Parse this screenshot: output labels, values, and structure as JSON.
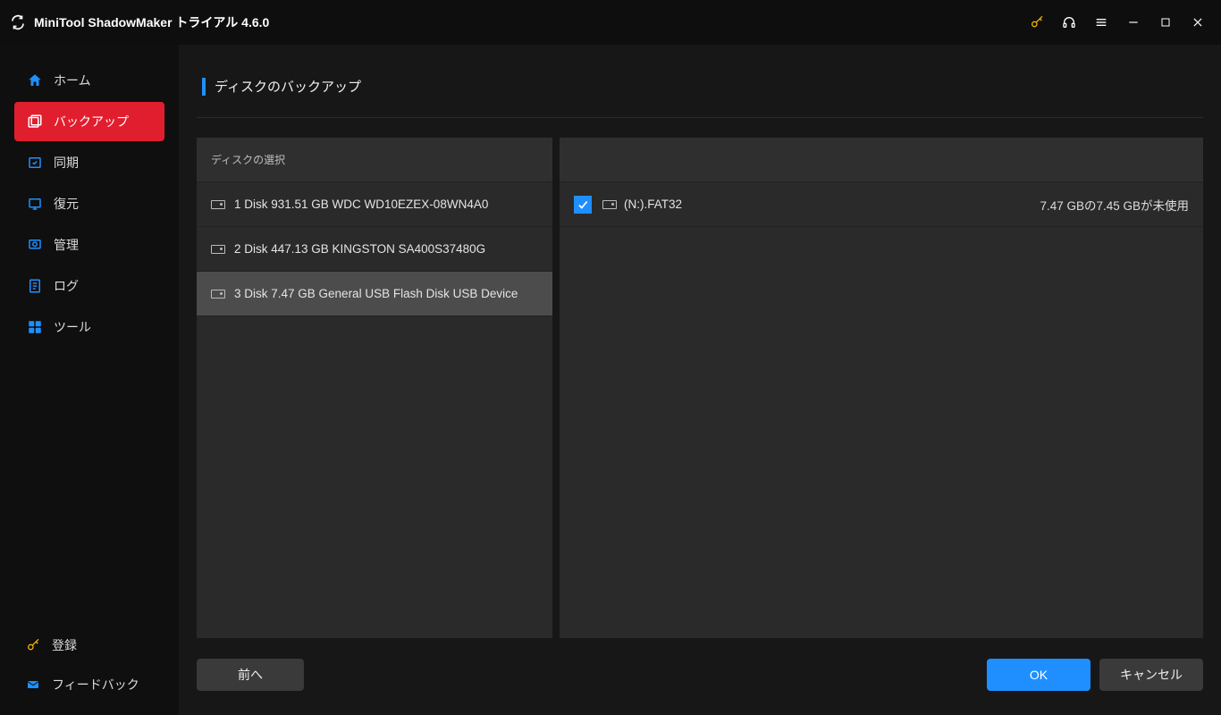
{
  "header": {
    "app_title": "MiniTool ShadowMaker トライアル 4.6.0"
  },
  "sidebar": {
    "items": [
      {
        "label": "ホーム"
      },
      {
        "label": "バックアップ"
      },
      {
        "label": "同期"
      },
      {
        "label": "復元"
      },
      {
        "label": "管理"
      },
      {
        "label": "ログ"
      },
      {
        "label": "ツール"
      }
    ],
    "bottom": [
      {
        "label": "登録"
      },
      {
        "label": "フィードバック"
      }
    ]
  },
  "page": {
    "title": "ディスクのバックアップ",
    "disk_select_header": "ディスクの選択"
  },
  "disks": [
    {
      "label": "1 Disk 931.51 GB WDC WD10EZEX-08WN4A0"
    },
    {
      "label": "2 Disk 447.13 GB KINGSTON SA400S37480G"
    },
    {
      "label": "3 Disk 7.47 GB General  USB Flash Disk   USB Device"
    }
  ],
  "partitions": [
    {
      "label": "(N:).FAT32",
      "usage": "7.47 GBの7.45 GBが未使用",
      "checked": true
    }
  ],
  "footer": {
    "back": "前へ",
    "ok": "OK",
    "cancel": "キャンセル"
  },
  "colors": {
    "accent_red": "#e11e2e",
    "accent_blue": "#1f8fff",
    "key_yellow": "#f5b400"
  }
}
